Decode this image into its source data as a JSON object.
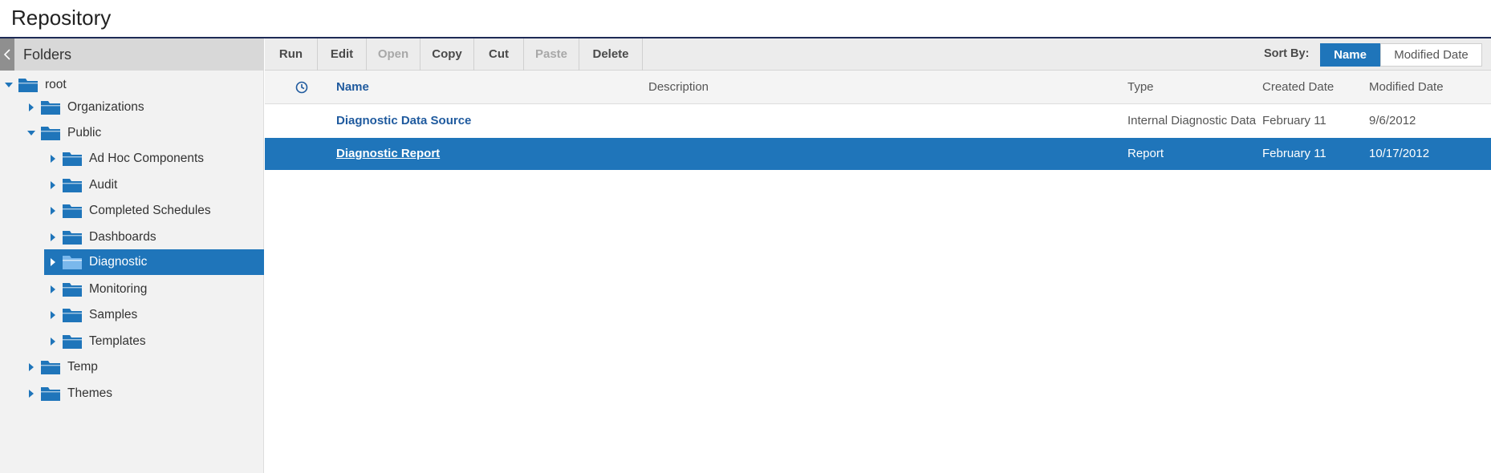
{
  "header": {
    "title": "Repository"
  },
  "folders_panel": {
    "title": "Folders",
    "tree": [
      {
        "label": "root"
      },
      {
        "label": "Organizations"
      },
      {
        "label": "Public"
      },
      {
        "label": "Ad Hoc Components"
      },
      {
        "label": "Audit"
      },
      {
        "label": "Completed Schedules"
      },
      {
        "label": "Dashboards"
      },
      {
        "label": "Diagnostic"
      },
      {
        "label": "Monitoring"
      },
      {
        "label": "Samples"
      },
      {
        "label": "Templates"
      },
      {
        "label": "Temp"
      },
      {
        "label": "Themes"
      }
    ]
  },
  "toolbar": {
    "run": "Run",
    "edit": "Edit",
    "open": "Open",
    "copy": "Copy",
    "cut": "Cut",
    "paste": "Paste",
    "delete": "Delete",
    "sort_by_label": "Sort By:",
    "sort_name": "Name",
    "sort_modified": "Modified Date"
  },
  "table": {
    "columns": {
      "name": "Name",
      "description": "Description",
      "type": "Type",
      "created": "Created Date",
      "modified": "Modified Date"
    },
    "rows": [
      {
        "name": "Diagnostic Data Source",
        "description": "",
        "type": "Internal Diagnostic Data",
        "created": "February 11",
        "modified": "9/6/2012"
      },
      {
        "name": "Diagnostic Report",
        "description": "",
        "type": "Report",
        "created": "February 11",
        "modified": "10/17/2012"
      }
    ]
  },
  "colors": {
    "accent": "#1f75ba",
    "header_rule": "#1d2a55",
    "link": "#1f5a9e"
  }
}
